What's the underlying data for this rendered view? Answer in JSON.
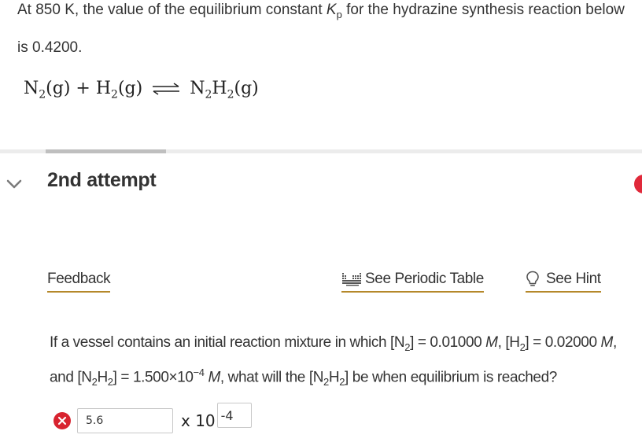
{
  "intro": {
    "part1": "At 850 K, the value of the equilibrium constant ",
    "kp_symbol": "K",
    "kp_subscript": "p",
    "part2": " for the hydrazine synthesis reaction below is 0.4200."
  },
  "equation": {
    "n": "N",
    "two_a": "2",
    "g1": "(g)",
    "plus": " + ",
    "h": "H",
    "two_b": "2",
    "g2": "(g)",
    "product_n": "N",
    "two_c": "2",
    "product_h": "H",
    "two_d": "2",
    "g3": "(g)"
  },
  "attempt": {
    "title": "2nd attempt"
  },
  "links": {
    "feedback": "Feedback",
    "periodic_table": "See Periodic Table",
    "hint": "See Hint"
  },
  "question": {
    "t1": "If a vessel contains an initial reaction mixture in which [N",
    "s1": "2",
    "t2": "] = 0.01000 ",
    "m1": "M",
    "t3": ", [H",
    "s2": "2",
    "t4": "] = 0.02000 ",
    "m2": "M",
    "t5": ", and [N",
    "s3": "2",
    "t6": "H",
    "s4": "2",
    "t7": "] = 1.500×10",
    "sup1": "−4",
    "t8": " ",
    "m3": "M",
    "t9": ", what will the [N",
    "s5": "2",
    "t10": "H",
    "s6": "2",
    "t11": "] be when equilibrium is reached?"
  },
  "answer": {
    "value": "5.6",
    "times_ten": "x 10",
    "exponent": "-4",
    "status": "incorrect"
  },
  "colors": {
    "link_underline": "#b5882a",
    "error_red": "#d8232f",
    "text": "#333333"
  }
}
